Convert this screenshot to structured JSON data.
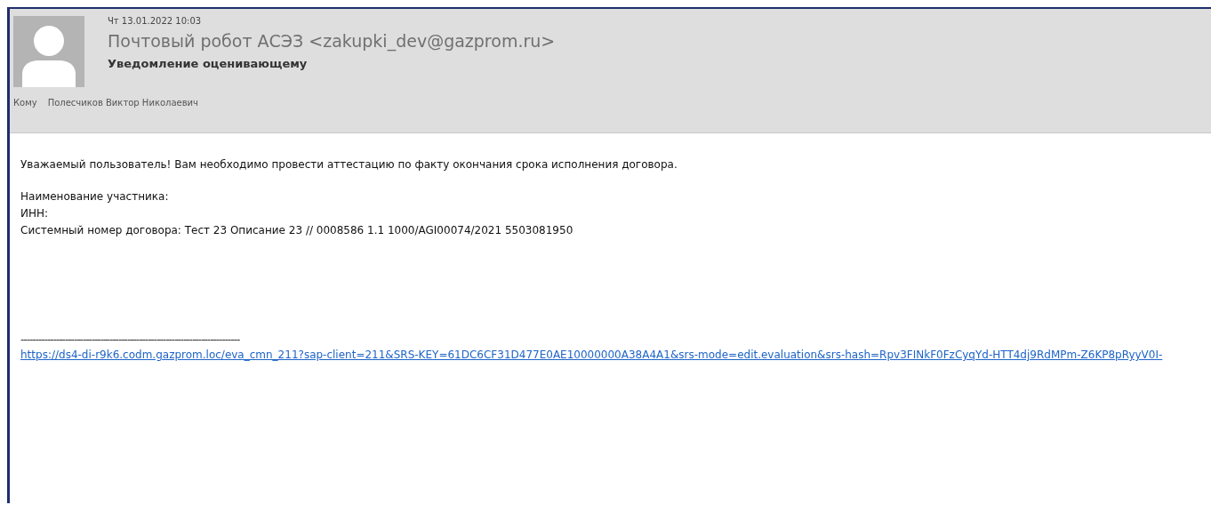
{
  "header": {
    "date": "Чт 13.01.2022 10:03",
    "sender": "Почтовый робот АСЭЗ <zakupki_dev@gazprom.ru>",
    "subject": "Уведомление оценивающему",
    "to_label": "Кому",
    "to": "Полесчиков Виктор Николаевич"
  },
  "body": {
    "greeting": "Уважаемый пользователь! Вам необходимо провести аттестацию по факту окончания срока исполнения договора.",
    "lines": [
      "Наименование участника:",
      "ИНН:",
      "Системный номер договора: Тест 23 Описание 23 // 0008586 1.1 1000/AGI00074/2021 5503081950"
    ],
    "separator": "--------------------------------------------------------------------------",
    "link": "https://ds4-di-r9k6.codm.gazprom.loc/eva_cmn_211?sap-client=211&SRS-KEY=61DC6CF31D477E0AE10000000A38A4A1&srs-mode=edit.evaluation&srs-hash=Rpv3FINkF0FzCyqYd-HTT4dj9RdMPm-Z6KP8pRyyV0I-"
  }
}
